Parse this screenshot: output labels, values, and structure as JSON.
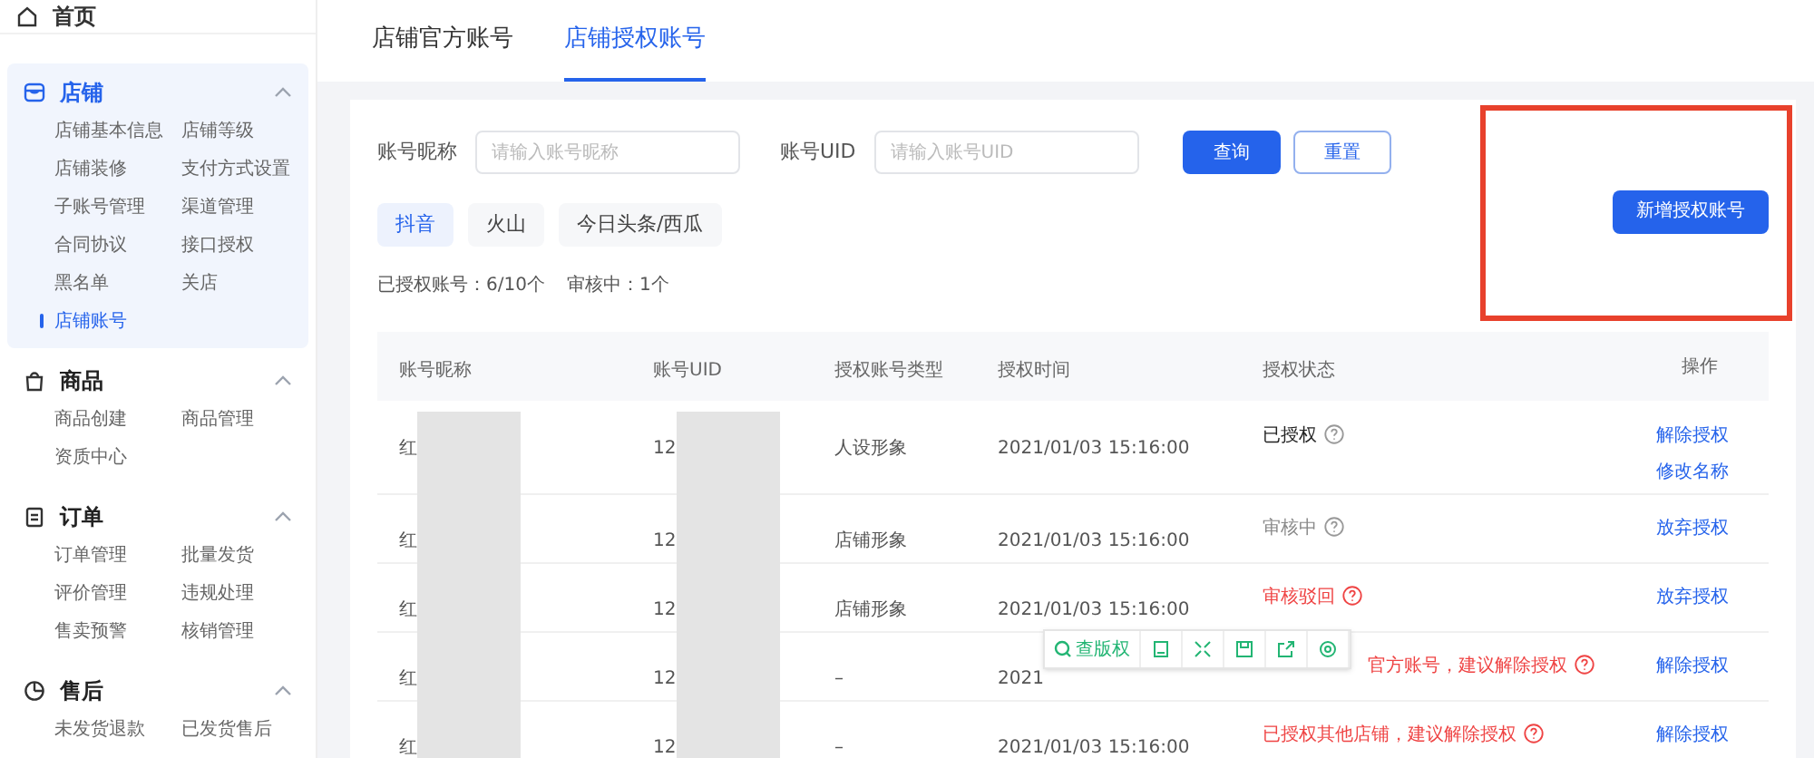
{
  "sidebar": {
    "home": {
      "label": "首页"
    },
    "groups": [
      {
        "label": "店铺",
        "expanded": true,
        "items": [
          {
            "label": "店铺基本信息",
            "selected": false
          },
          {
            "label": "店铺等级",
            "selected": false
          },
          {
            "label": "店铺装修",
            "selected": false
          },
          {
            "label": "支付方式设置",
            "selected": false
          },
          {
            "label": "子账号管理",
            "selected": false
          },
          {
            "label": "渠道管理",
            "selected": false
          },
          {
            "label": "合同协议",
            "selected": false
          },
          {
            "label": "接口授权",
            "selected": false
          },
          {
            "label": "黑名单",
            "selected": false
          },
          {
            "label": "关店",
            "selected": false
          },
          {
            "label": "店铺账号",
            "selected": true
          }
        ]
      },
      {
        "label": "商品",
        "expanded": true,
        "items": [
          {
            "label": "商品创建",
            "selected": false
          },
          {
            "label": "商品管理",
            "selected": false
          },
          {
            "label": "资质中心",
            "selected": false
          }
        ]
      },
      {
        "label": "订单",
        "expanded": true,
        "items": [
          {
            "label": "订单管理",
            "selected": false
          },
          {
            "label": "批量发货",
            "selected": false
          },
          {
            "label": "评价管理",
            "selected": false
          },
          {
            "label": "违规处理",
            "selected": false
          },
          {
            "label": "售卖预警",
            "selected": false
          },
          {
            "label": "核销管理",
            "selected": false
          }
        ]
      },
      {
        "label": "售后",
        "expanded": true,
        "items": [
          {
            "label": "未发货退款",
            "selected": false
          },
          {
            "label": "已发货售后",
            "selected": false
          }
        ]
      }
    ]
  },
  "tabs": [
    {
      "label": "店铺官方账号",
      "selected": false
    },
    {
      "label": "店铺授权账号",
      "selected": true
    }
  ],
  "filters": [
    {
      "label": "账号昵称",
      "placeholder": "请输入账号昵称"
    },
    {
      "label": "账号UID",
      "placeholder": "请输入账号UID"
    }
  ],
  "query_button": "查询",
  "reset_button": "重置",
  "platform_tabs": [
    {
      "label": "抖音",
      "selected": true
    },
    {
      "label": "火山",
      "selected": false
    },
    {
      "label": "今日头条/西瓜",
      "selected": false
    }
  ],
  "summary": [
    "已授权账号：6/10个",
    "审核中：1个"
  ],
  "add_button": "新增授权账号",
  "table": {
    "columns": [
      "账号昵称",
      "账号UID",
      "授权账号类型",
      "授权时间",
      "授权状态",
      "操作"
    ],
    "rows": [
      {
        "nickname": "红",
        "uid": "12",
        "type": "人设形象",
        "time": "2021/01/03 15:16:00",
        "status": {
          "text": "已授权",
          "kind": "ok"
        },
        "actions": [
          "解除授权",
          "修改名称"
        ]
      },
      {
        "nickname": "红",
        "uid": "12",
        "type": "店铺形象",
        "time": "2021/01/03 15:16:00",
        "status": {
          "text": "审核中",
          "kind": "pending"
        },
        "actions": [
          "放弃授权"
        ]
      },
      {
        "nickname": "红",
        "uid": "12",
        "type": "店铺形象",
        "time": "2021/01/03 15:16:00",
        "status": {
          "text": "审核驳回",
          "kind": "error"
        },
        "actions": [
          "放弃授权"
        ]
      },
      {
        "nickname": "红",
        "uid": "12",
        "type": "–",
        "time": "2021",
        "status": {
          "text": "官方账号，建议解除授权",
          "kind": "error",
          "covered": true
        },
        "actions": [
          "解除授权"
        ]
      },
      {
        "nickname": "红",
        "uid": "12",
        "type": "–",
        "time": "2021/01/03 15:16:00",
        "status": {
          "text": "已授权其他店铺，建议解除授权",
          "kind": "error"
        },
        "actions": [
          "解除授权"
        ]
      }
    ]
  },
  "floating_toolbar": {
    "label": "查版权"
  }
}
